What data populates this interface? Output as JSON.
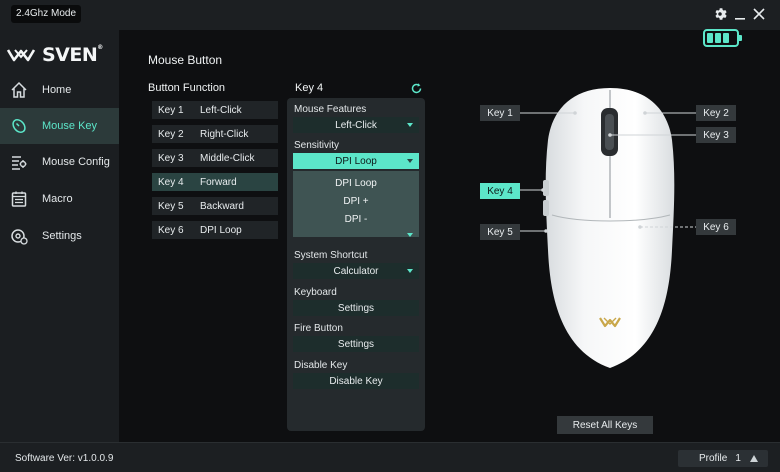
{
  "app": {
    "mode": "2.4Ghz Mode",
    "logo_text": "SVEN",
    "logo_mark": "®"
  },
  "window": {
    "settings_icon": "gear-icon",
    "minimize_icon": "minimize-icon",
    "close_icon": "close-icon"
  },
  "battery": {
    "level": 1.0,
    "color": "#5ce6c9"
  },
  "sidebar": {
    "items": [
      {
        "label": "Home",
        "icon": "home-icon",
        "active": false
      },
      {
        "label": "Mouse Key",
        "icon": "mouse-key-icon",
        "active": true
      },
      {
        "label": "Mouse Config",
        "icon": "config-icon",
        "active": false
      },
      {
        "label": "Macro",
        "icon": "macro-icon",
        "active": false
      },
      {
        "label": "Settings",
        "icon": "settings-icon",
        "active": false
      }
    ]
  },
  "main": {
    "title": "Mouse Button",
    "button_function_label": "Button Function",
    "keys": [
      {
        "name": "Key 1",
        "function": "Left-Click"
      },
      {
        "name": "Key 2",
        "function": "Right-Click"
      },
      {
        "name": "Key 3",
        "function": "Middle-Click"
      },
      {
        "name": "Key 4",
        "function": "Forward"
      },
      {
        "name": "Key 5",
        "function": "Backward"
      },
      {
        "name": "Key 6",
        "function": "DPI Loop"
      }
    ],
    "selected_key": "Key 4"
  },
  "panel": {
    "title": "Key 4",
    "mouse_features_label": "Mouse Features",
    "mouse_features_value": "Left-Click",
    "sensitivity_label": "Sensitivity",
    "sensitivity_value": "DPI Loop",
    "sensitivity_options": [
      "DPI Loop",
      "DPI +",
      "DPI -"
    ],
    "system_shortcut_label": "System Shortcut",
    "system_shortcut_value": "Calculator",
    "keyboard_label": "Keyboard",
    "keyboard_button": "Settings",
    "fire_button_label": "Fire Button",
    "fire_button_button": "Settings",
    "disable_key_label": "Disable Key",
    "disable_key_button": "Disable Key"
  },
  "mouse_tags": {
    "key1": "Key 1",
    "key2": "Key 2",
    "key3": "Key 3",
    "key4": "Key 4",
    "key5": "Key 5",
    "key6": "Key 6"
  },
  "reset_button": "Reset All Keys",
  "footer": {
    "version": "Software Ver: v1.0.0.9",
    "profile_label": "Profile",
    "profile_number": "1"
  },
  "colors": {
    "accent": "#5ce6c9",
    "selected_row": "#2a4442",
    "gold_logo": "#c9a74a"
  }
}
